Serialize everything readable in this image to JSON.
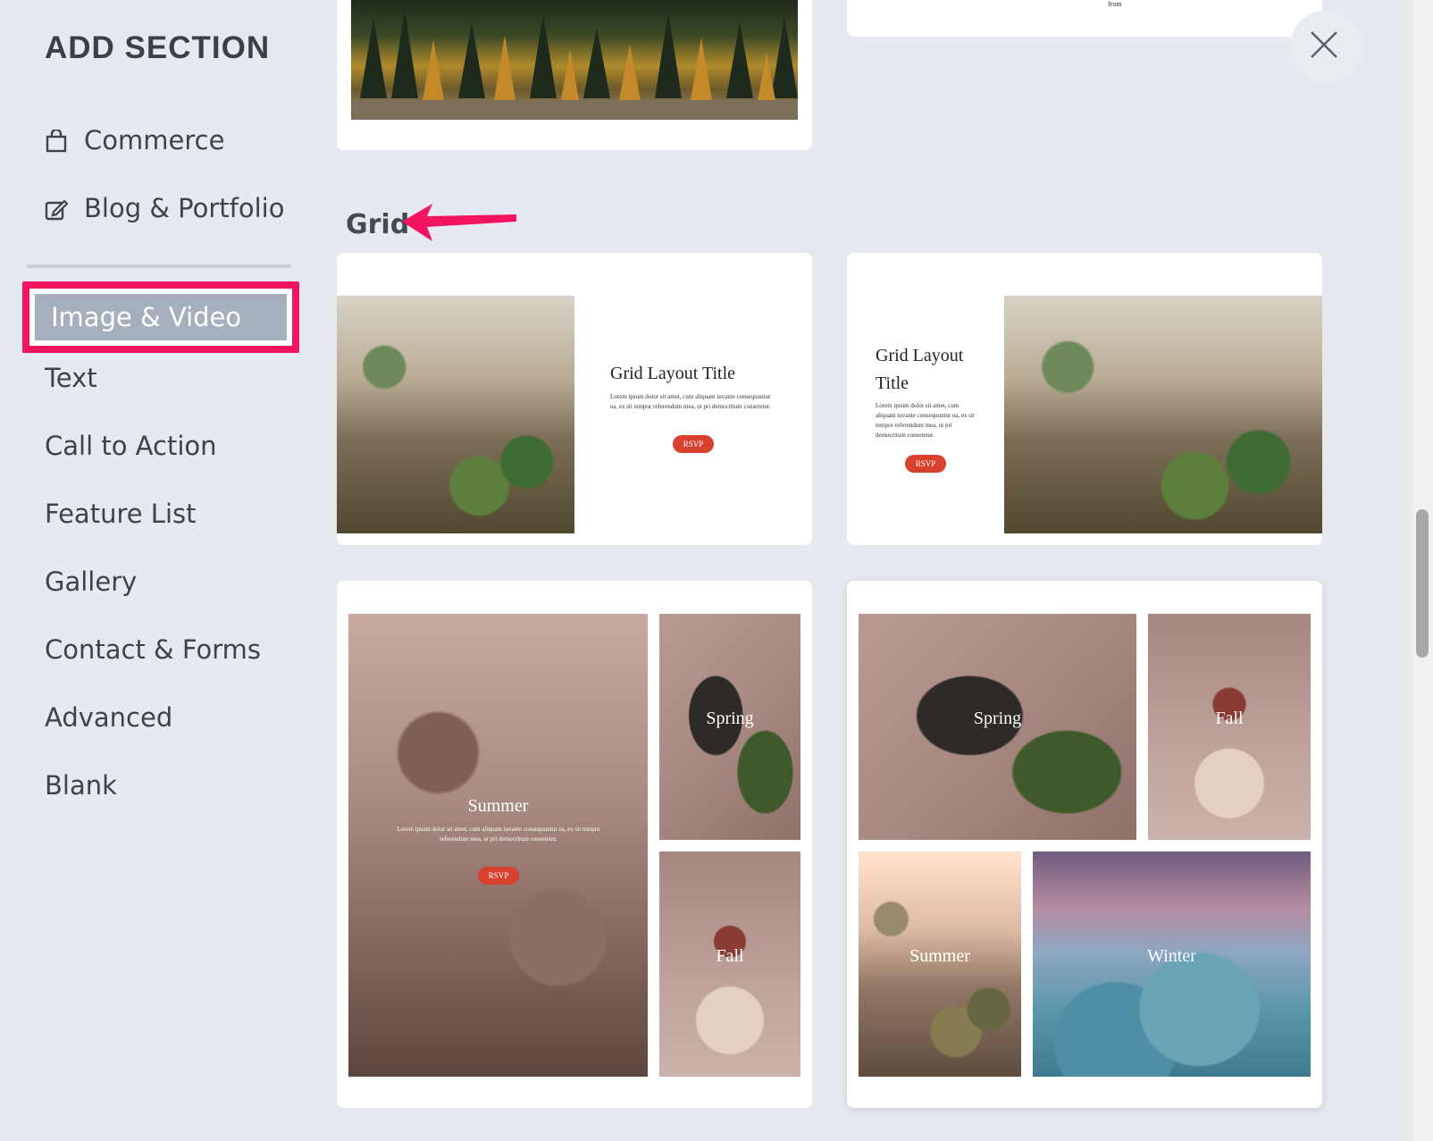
{
  "sidebar": {
    "title": "ADD SECTION",
    "items": [
      {
        "label": "Commerce",
        "icon": "shopping-bag-icon"
      },
      {
        "label": "Blog & Portfolio",
        "icon": "edit-icon"
      },
      {
        "label": "Image & Video",
        "selected": true
      },
      {
        "label": "Text"
      },
      {
        "label": "Call to Action"
      },
      {
        "label": "Feature List"
      },
      {
        "label": "Gallery"
      },
      {
        "label": "Contact & Forms"
      },
      {
        "label": "Advanced"
      },
      {
        "label": "Blank"
      }
    ]
  },
  "main": {
    "top_small_text": "from",
    "section_label": "Grid",
    "cards": [
      {
        "title": "Grid Layout Title",
        "body": "Lorem ipsum dolor sit amet, cum aliquam iuvante consequuntur ea, ex sit tempor referendum mea, ut pri democritum consetetur.",
        "button": "RSVP"
      },
      {
        "title": "Grid Layout Title",
        "body": "Lorem ipsum dolor sit amet, cum aliquam iuvante consequuntur ea, ex sit tempor referendum mea, ut pri democritum consetetur.",
        "button": "RSVP"
      }
    ],
    "grid_card_a": {
      "summer": "Summer",
      "summer_body": "Lorem ipsum dolor sit amet, cum aliquam iuvante consequuntur ea, ex sit tempor referendum mea, ut pri democritum consetetur.",
      "summer_button": "RSVP",
      "spring": "Spring",
      "fall": "Fall"
    },
    "grid_card_b": {
      "spring": "Spring",
      "fall": "Fall",
      "summer": "Summer",
      "winter": "Winter"
    }
  },
  "colors": {
    "highlight": "#f2145f",
    "selected_bg": "#a6afbd",
    "arrow": "#f2145f",
    "button": "#d9412f"
  }
}
